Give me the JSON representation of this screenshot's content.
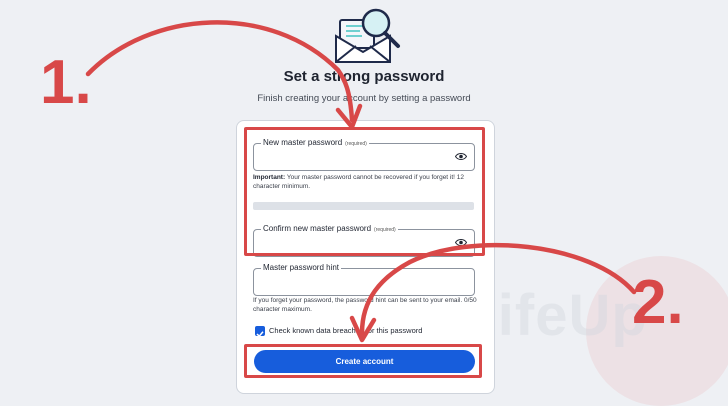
{
  "header": {
    "title": "Set a strong password",
    "subtitle": "Finish creating your account by setting a password"
  },
  "form": {
    "new_password": {
      "label": "New master password",
      "required_tag": "(required)",
      "value": ""
    },
    "important_prefix": "Important:",
    "important_text": "Your master password cannot be recovered if you forget it! 12 character minimum.",
    "confirm_password": {
      "label": "Confirm new master password",
      "required_tag": "(required)",
      "value": ""
    },
    "hint": {
      "label": "Master password hint",
      "value": "",
      "help": "If you forget your password, the password hint can be sent to your email. 0/50 character maximum."
    },
    "breach_check": {
      "label": "Check known data breaches for this password",
      "checked": true
    },
    "submit_label": "Create account"
  },
  "annotations": {
    "step1": "1.",
    "step2": "2.",
    "color": "#d84848"
  },
  "watermark": {
    "text": "PiMyLifeUp"
  },
  "colors": {
    "primary": "#175ddc",
    "background": "#eef0f4"
  }
}
